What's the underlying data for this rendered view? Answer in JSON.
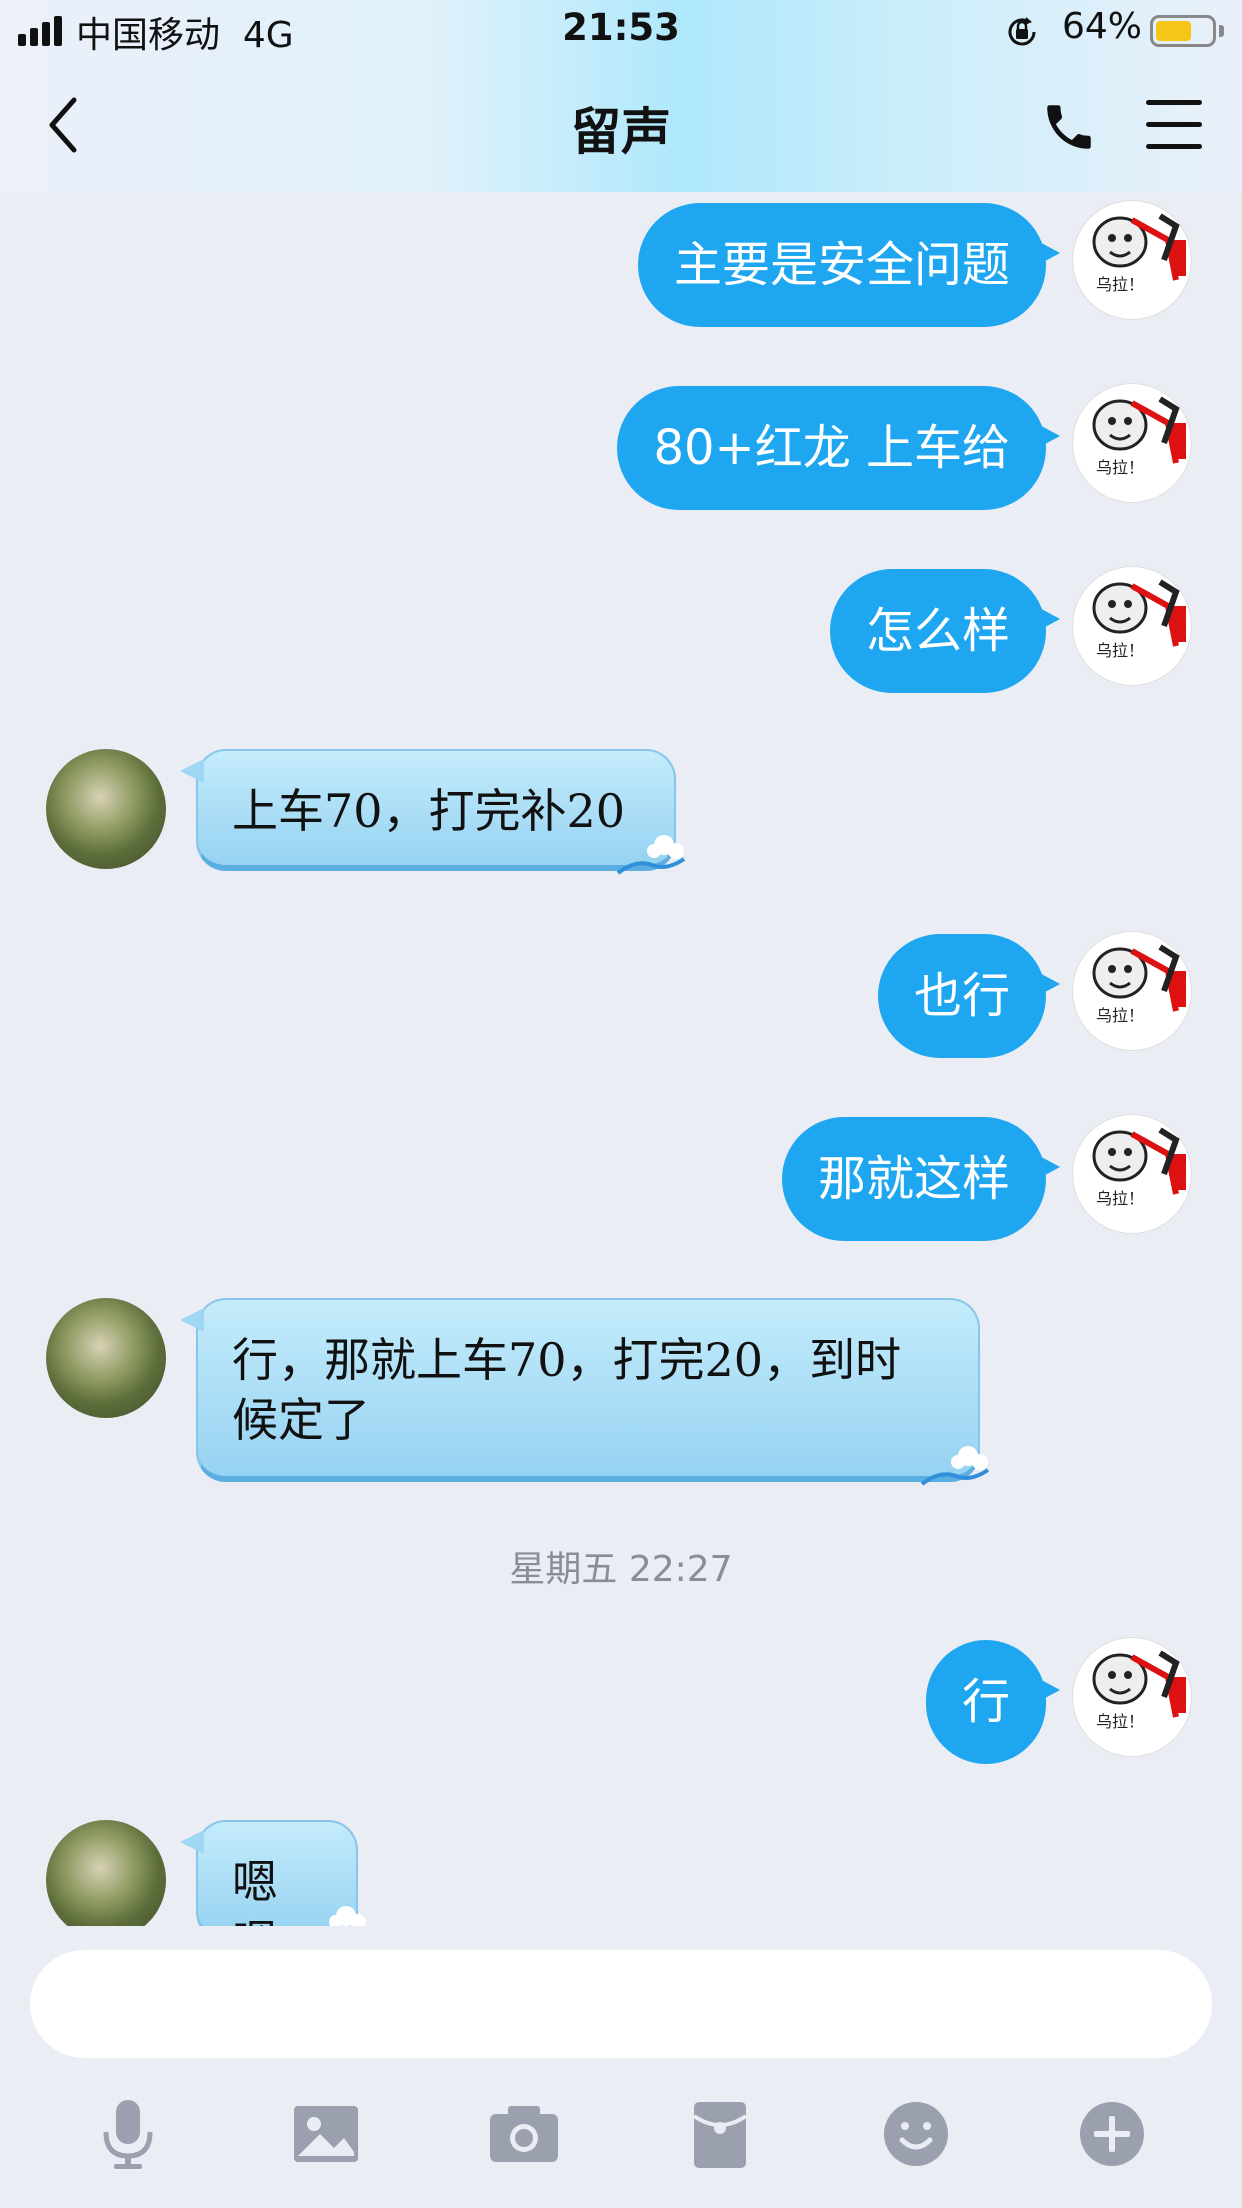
{
  "status_bar": {
    "carrier": "中国移动",
    "network": "4G",
    "time": "21:53",
    "battery_percent": "64%",
    "battery_level": 0.64
  },
  "nav": {
    "title": "留声",
    "back_icon": "chevron-left-icon",
    "call_icon": "phone-icon",
    "menu_icon": "hamburger-menu-icon"
  },
  "messages": [
    {
      "sender": "me",
      "text": "主要是安全问题"
    },
    {
      "sender": "me",
      "text": "80+红龙 上车给"
    },
    {
      "sender": "me",
      "text": "怎么样"
    },
    {
      "sender": "other",
      "text": "上车70，打完补20"
    },
    {
      "sender": "me",
      "text": "也行"
    },
    {
      "sender": "me",
      "text": "那就这样"
    },
    {
      "sender": "other",
      "text": "行，那就上车70，打完20，到时候定了"
    },
    {
      "sender": "me",
      "text": "行"
    },
    {
      "sender": "other",
      "text": "嗯嗯"
    }
  ],
  "timestamp": "星期五 22:27",
  "avatar_me_label": "乌拉！",
  "composer": {
    "placeholder": "",
    "tools": [
      "microphone-icon",
      "image-icon",
      "camera-icon",
      "red-packet-icon",
      "emoji-icon",
      "plus-icon"
    ]
  },
  "colors": {
    "my_bubble": "#1ea7f0",
    "background": "#ebedf5",
    "icon_gray": "#9aa0ae"
  }
}
